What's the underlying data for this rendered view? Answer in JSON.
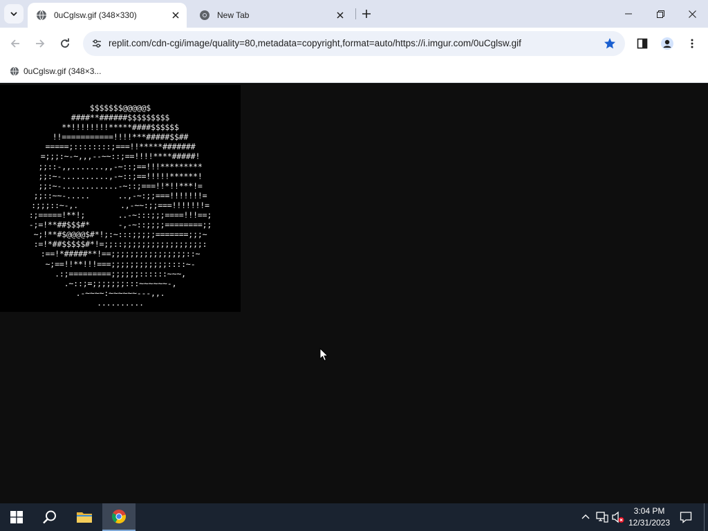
{
  "browser": {
    "tabs": [
      {
        "title": "0uCglsw.gif (348×330)",
        "active": true
      },
      {
        "title": "New Tab",
        "active": false
      }
    ],
    "url": "replit.com/cdn-cgi/image/quality=80,metadata=copyright,format=auto/https://i.imgur.com/0uCglsw.gif",
    "bookmarked": true,
    "bookmarks": [
      {
        "label": "0uCglsw.gif (348×3..."
      }
    ]
  },
  "image": {
    "ascii_lines": [
      "$$$$$$$@@@@@$",
      "####**######$$$$$$$$$",
      "**!!!!!!!!*****####$$$$$$",
      "!!===========!!!!***#####$$##",
      "=====;::::::::;===!!*****#######",
      "=;;;:~-~,,,--~~::;==!!!!****#####!",
      ";;::-,,.......,,-~::;==!!!*********",
      ";;:~-..........,-~::;==!!!!!******!",
      ";;:~-............-~::;===!!*!!***!=",
      ";;::~~-.....      ..,-~:;;===!!!!!!!=",
      ":;;;::~-,.         .,-~~:;;===!!!!!!!=",
      ":;=====!**!;       ..-~:::;;;====!!!==;",
      "-;=!**##$$$#*      -,-~::;;;;========;;",
      "~;!**#$@@@@$#*!;:~:::;;;;;=======;;;~",
      ":=!*##$$$$$#*!=;;::;;;;;;;;;;;;;;;;;:",
      ":==!*#####**!==;;;;;;;;;;;;;;;;::~",
      "~;==!!**!!!===;;;;;;;;;;;;::::~-",
      ".:;=========;;;;;;::::::~~~,",
      ".~::;=;;;;;;;:::~~~~~~-,",
      ".-~~~~:~~~~~~---,,.",
      ".........."
    ]
  },
  "taskbar": {
    "time": "3:04 PM",
    "date": "12/31/2023",
    "pinned": [
      "start-button",
      "search-button",
      "file-explorer",
      "chrome"
    ]
  }
}
